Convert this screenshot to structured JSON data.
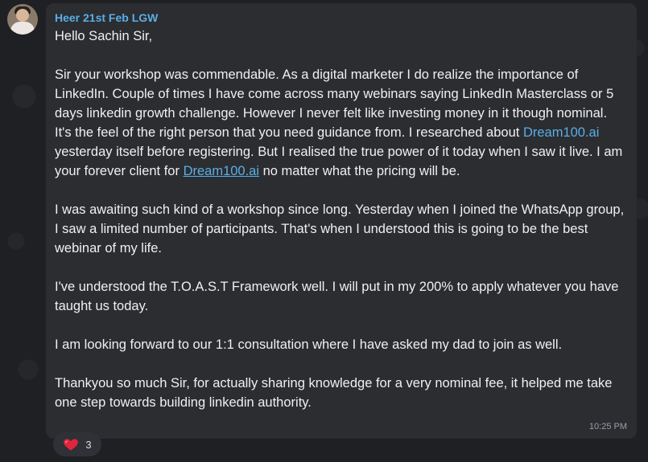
{
  "message": {
    "sender": "Heer 21st Feb LGW",
    "greeting": "Hello Sachin Sir,",
    "p1_a": "Sir your workshop was commendable. As a digital marketer I do realize the importance of LinkedIn. Couple of times I have come across many webinars saying LinkedIn Masterclass or 5 days linkedin growth challenge. However I never felt like investing money in it though nominal. It's the feel of the right person that you need guidance from. I researched about ",
    "link1": "Dream100.ai",
    "p1_b": " yesterday itself before registering. But I realised the true power of it today when I saw it live. I am your forever client for ",
    "link2": "Dream100.ai",
    "p1_c": " no matter what the pricing will be.",
    "p2": "I was awaiting such kind of a workshop since long. Yesterday when I joined the WhatsApp group, I saw a limited number of participants. That's when I understood this is going to be the best webinar of my life.",
    "p3": "I've understood the T.O.A.S.T Framework well. I will put in my 200% to apply whatever you have taught us today.",
    "p4": "I am looking forward to our 1:1 consultation where I have asked my dad to join as well.",
    "p5": "Thankyou so much Sir, for actually sharing knowledge for a very nominal fee, it helped me take one step towards building linkedin authority.",
    "time": "10:25 PM"
  },
  "reaction": {
    "icon": "heart-icon",
    "count": "3",
    "color": "#e0243a"
  }
}
